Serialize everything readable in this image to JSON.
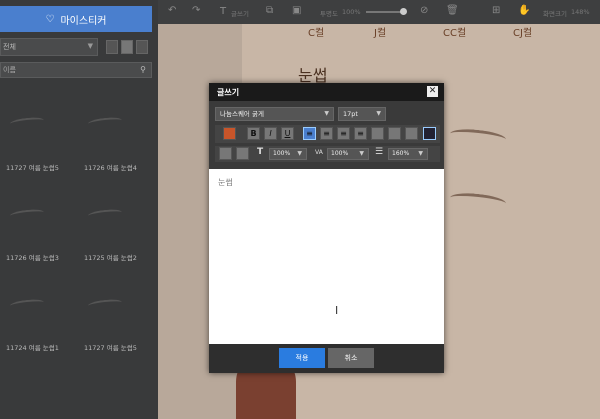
{
  "sidebar": {
    "mysticker_label": "마이스티커",
    "category": "전체",
    "search_placeholder": "이름",
    "items": [
      {
        "label": "11727 여름 눈썹5"
      },
      {
        "label": "11726 여름 눈썹4"
      },
      {
        "label": "11726 여름 눈썹3"
      },
      {
        "label": "11725 여름 눈썹2"
      },
      {
        "label": "11724 여름 눈썹1"
      },
      {
        "label": "11727 여름 눈썹5"
      }
    ]
  },
  "toolbar": {
    "text_label": "글쓰기",
    "opacity_label": "투명도",
    "opacity_value": "100%",
    "zoom_label": "화면크기",
    "zoom_value": "148%"
  },
  "canvas": {
    "cups": [
      "C컬",
      "J컬",
      "CC컬",
      "CJ컬"
    ],
    "heading": "눈썹"
  },
  "dialog": {
    "title": "글쓰기",
    "font_family": "나눔스퀘어 굵게",
    "font_size": "17pt",
    "char_width": "100%",
    "letter_spacing": "100%",
    "line_height": "160%",
    "text": "눈썹",
    "apply_label": "적용",
    "cancel_label": "취소",
    "text_color": "#c8552a"
  }
}
